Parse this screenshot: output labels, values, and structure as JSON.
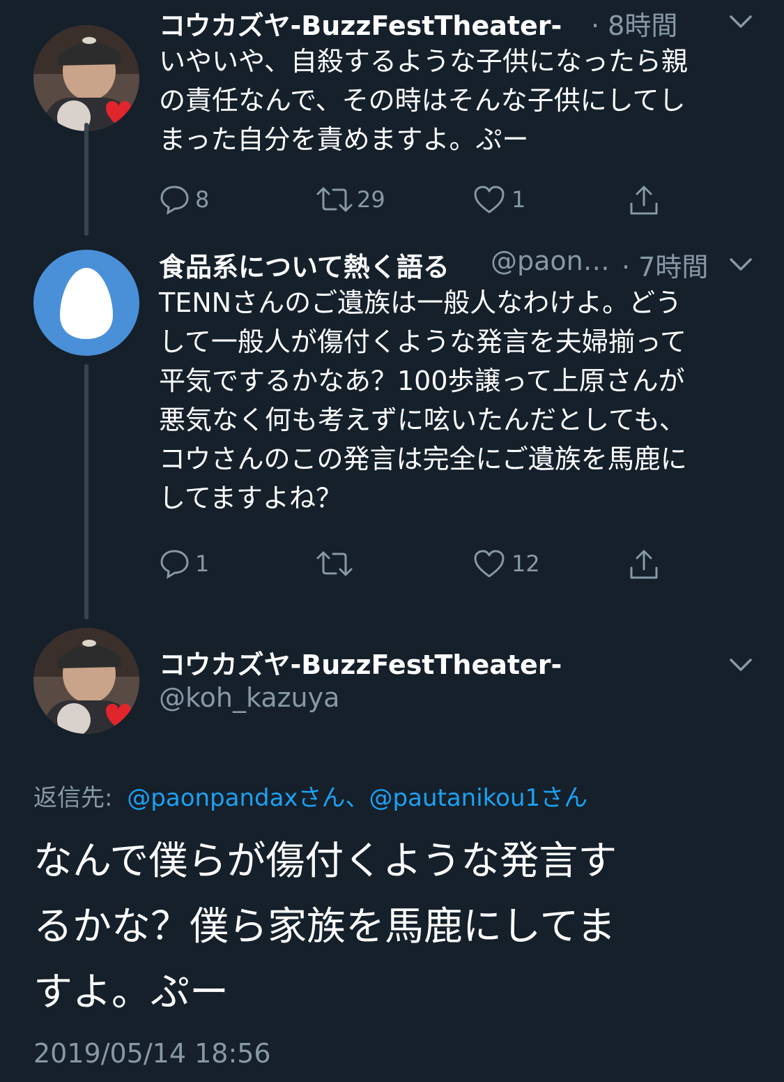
{
  "tweets": [
    {
      "name": "コウカズヤ-BuzzFestTheater-",
      "meta": "· 8時間",
      "text": "いやいや、自殺するような子供になったら親\nの責任なんで、その時はそんな子供にしてし\nまった自分を責めますよ。ぷー",
      "replies": "8",
      "retweets": "29",
      "likes": "1"
    },
    {
      "name": "食品系について熱く語る",
      "handle": "@paon…",
      "meta": "· 7時間",
      "text": "TENNさんのご遺族は一般人なわけよ。どう\nして一般人が傷付くような発言を夫婦揃って\n平気でするかなあ？100歩譲って上原さんが\n悪気なく何も考えずに呟いたんだとしても、\nコウさんのこの発言は完全にご遺族を馬鹿に\nしてますよね？",
      "replies": "1",
      "retweets": "",
      "likes": "12"
    }
  ],
  "main": {
    "name": "コウカズヤ-BuzzFestTheater-",
    "handle": "@koh_kazuya",
    "reply_label": "返信先:",
    "reply_users": "@paonpandaxさん、@pautanikou1さん",
    "text": "なんで僕らが傷付くような発言す\nるかな？僕ら家族を馬鹿にしてま\nすよ。ぷー",
    "timestamp": "2019/05/14 18:56"
  },
  "colors": {
    "background": "#15202b",
    "text": "#ffffff",
    "muted": "#8899a6",
    "link": "#1da1f2",
    "thread_line": "#38444d",
    "egg_avatar": "#4a90d9"
  }
}
